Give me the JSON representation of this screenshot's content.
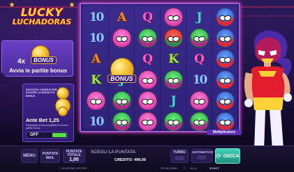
{
  "logo": {
    "line1": "LUCKY",
    "line2": "LUCHADORAS"
  },
  "bonus_panel": {
    "multiplier": "4x",
    "coin_label": "BONUS",
    "text": "Avvia le partite bonus"
  },
  "ante_panel": {
    "info": "RACCOGLI 4 BONUS PER AVVIARE LA MODALITÀ BONUS",
    "title": "Ante Bet 1,25",
    "desc": "Raddoppia la tua possibilità di vincere partite bonus",
    "toggle_label": "OFF",
    "toggle_state": "off"
  },
  "reels": {
    "columns": [
      [
        "10",
        "10",
        "A",
        "K",
        "mask-pink",
        "10"
      ],
      [
        "A",
        "mask-pink",
        "BONUS",
        "J",
        "mask-green",
        "mask-green"
      ],
      [
        "Q",
        "mask-green",
        "Q",
        "mask-pink",
        "mask-pink",
        "mask-pink"
      ],
      [
        "mask-pink",
        "mask-red",
        "K",
        "mask-green",
        "J",
        "mask-green"
      ],
      [
        "J",
        "mask-green",
        "Q",
        "10",
        "mask-pink",
        "mask-green"
      ],
      [
        "mask-blue",
        "mask-blue",
        "mask-blue",
        "mask-blue",
        "mask-blue",
        "mask-blue"
      ]
    ],
    "bonus_label": "BONUS"
  },
  "multiplier_label": "Moltiplicatore",
  "bottom": {
    "menu": "MENU",
    "bet_max": "PUNTATA MAX.",
    "bet_total_label": "PUNTATA TOTALE",
    "bet_total_value": "1,00",
    "choose_bet": "SCEGLI LA PUNTATA",
    "credit_label": "CREDITO:",
    "credit_value": "499,00",
    "turbo": "TURBO",
    "auto": "AUTOMATICO",
    "play": "GIOCA",
    "fullscreen": "SCHERMO INTERO",
    "game_id": "23785139993",
    "time": "08:15",
    "brand": "SYNOT"
  },
  "colors": {
    "accent": "#a05ad8",
    "bonus_panel": "#6a3fc4",
    "toggle_on": "#57df3f",
    "play_button": "#2fb8a0"
  }
}
